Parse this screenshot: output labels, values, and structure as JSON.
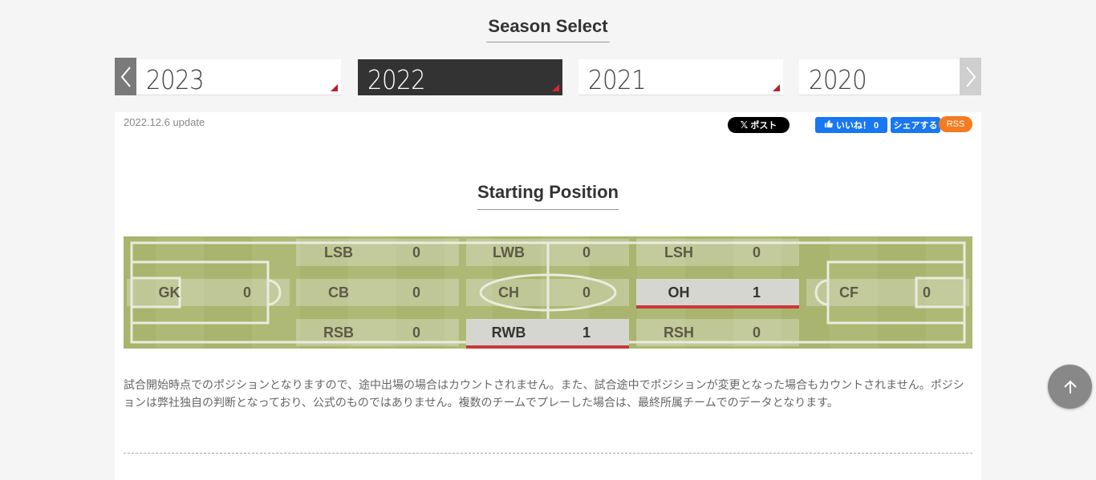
{
  "season_select": {
    "title": "Season Select",
    "prev_icon": "chevron-left-icon",
    "next_icon": "chevron-right-icon",
    "years": [
      "2023",
      "2022",
      "2021",
      "2020"
    ],
    "active_year": "2022"
  },
  "panel": {
    "update_text": "2022.12.6 update",
    "social": {
      "x_post": "ポスト",
      "like": "いいね！ 0",
      "share": "シェアする",
      "rss": "RSS"
    }
  },
  "starting_position": {
    "title": "Starting Position",
    "positions": [
      {
        "name": "GK",
        "value": "0"
      },
      {
        "name": "LSB",
        "value": "0"
      },
      {
        "name": "CB",
        "value": "0"
      },
      {
        "name": "RSB",
        "value": "0"
      },
      {
        "name": "LWB",
        "value": "0"
      },
      {
        "name": "CH",
        "value": "0"
      },
      {
        "name": "RWB",
        "value": "1"
      },
      {
        "name": "LSH",
        "value": "0"
      },
      {
        "name": "OH",
        "value": "1"
      },
      {
        "name": "RSH",
        "value": "0"
      },
      {
        "name": "CF",
        "value": "0"
      }
    ],
    "note": "試合開始時点でのポジションとなりますので、途中出場の場合はカウントされません。また、試合途中でポジションが変更となった場合もカウントされません。ポジションは弊社独自の判断となっており、公式のものではありません。複数のチームでプレーした場合は、最終所属チームでのデータとなります。"
  },
  "colors": {
    "accent_red": "#c8393b",
    "pitch_green": "#a9b46e",
    "active_tab": "#333333",
    "rss_orange": "#f47b20",
    "facebook_blue": "#1877f2"
  },
  "scroll_top_icon": "arrow-up-icon"
}
